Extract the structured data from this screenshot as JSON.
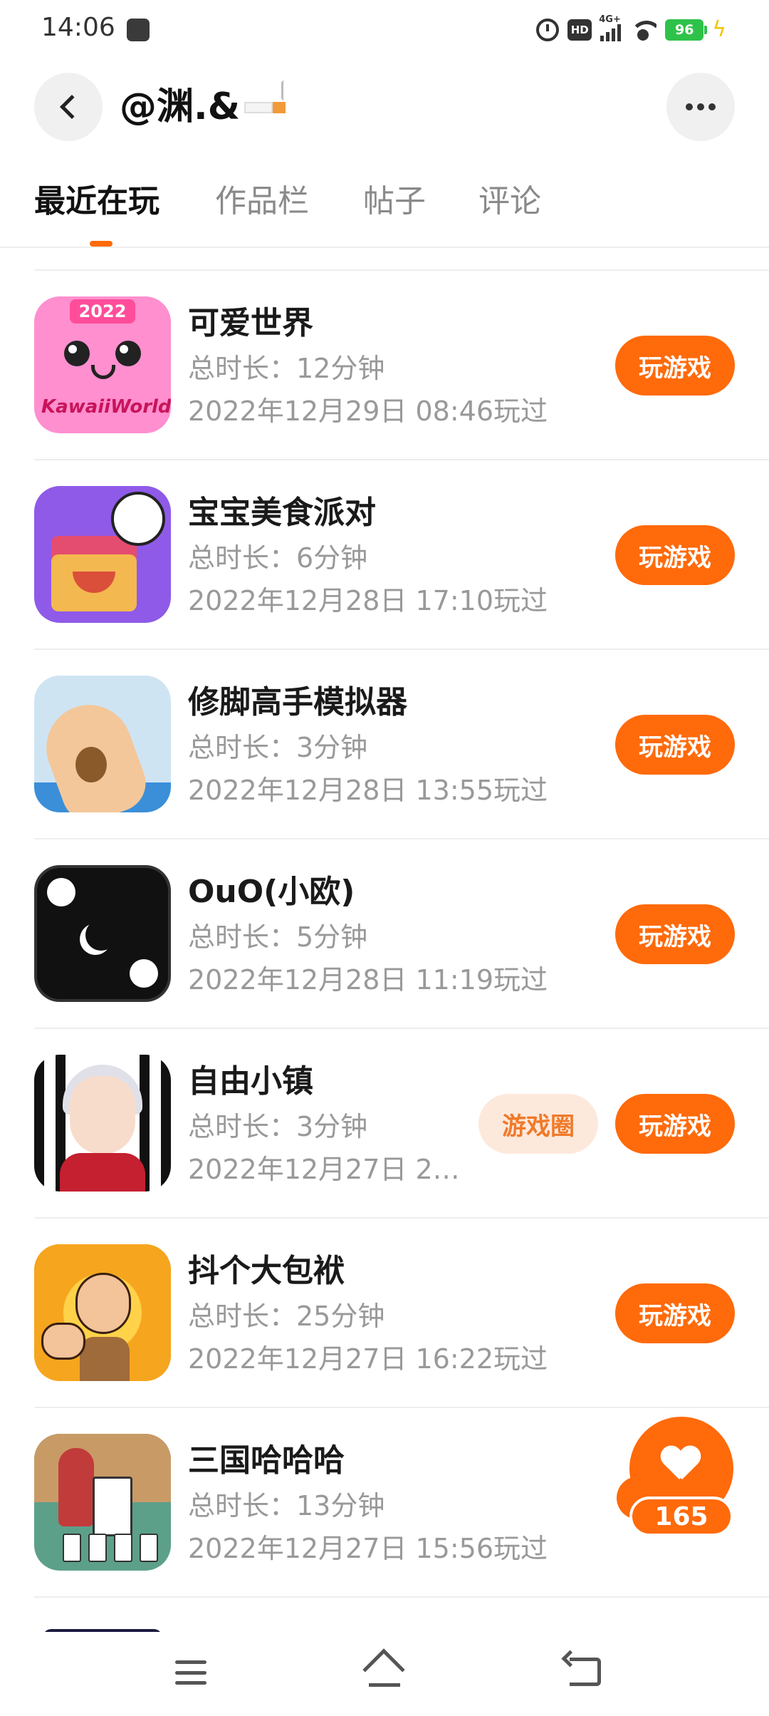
{
  "status_bar": {
    "time": "14:06",
    "hd": "HD",
    "network": "4G+",
    "battery": "96"
  },
  "header": {
    "title": "@渊.&"
  },
  "tabs": [
    {
      "label": "最近在玩",
      "active": true
    },
    {
      "label": "作品栏",
      "active": false
    },
    {
      "label": "帖子",
      "active": false
    },
    {
      "label": "评论",
      "active": false
    }
  ],
  "games": [
    {
      "name": "可爱世界",
      "duration": "总时长：12分钟",
      "last_played": "2022年12月29日 08:46玩过",
      "icon": "kawaii-world-icon",
      "icon_year": "2022",
      "icon_logo": "KawaiiWorld",
      "play_label": "玩游戏"
    },
    {
      "name": "宝宝美食派对",
      "duration": "总时长：6分钟",
      "last_played": "2022年12月28日 17:10玩过",
      "icon": "baby-food-party-icon",
      "play_label": "玩游戏"
    },
    {
      "name": "修脚高手模拟器",
      "duration": "总时长：3分钟",
      "last_played": "2022年12月28日 13:55玩过",
      "icon": "pedicure-simulator-icon",
      "play_label": "玩游戏"
    },
    {
      "name": "OuO(小欧)",
      "duration": "总时长：5分钟",
      "last_played": "2022年12月28日 11:19玩过",
      "icon": "ouo-dice-icon",
      "play_label": "玩游戏"
    },
    {
      "name": "自由小镇",
      "duration": "总时长：3分钟",
      "last_played": "2022年12月27日 2…",
      "icon": "free-town-icon",
      "circle_label": "游戏圈",
      "play_label": "玩游戏"
    },
    {
      "name": "抖个大包袱",
      "duration": "总时长：25分钟",
      "last_played": "2022年12月27日 16:22玩过",
      "icon": "big-bundle-icon",
      "play_label": "玩游戏"
    },
    {
      "name": "三国哈哈哈",
      "duration": "总时长：13分钟",
      "last_played": "2022年12月27日 15:56玩过",
      "icon": "three-kingdoms-haha-icon",
      "play_label": "玩游戏"
    }
  ],
  "like_fab": {
    "count": "165"
  },
  "colors": {
    "accent": "#ff6a0a",
    "circle_bg": "#fde9dc",
    "secondary_text": "#999999"
  }
}
